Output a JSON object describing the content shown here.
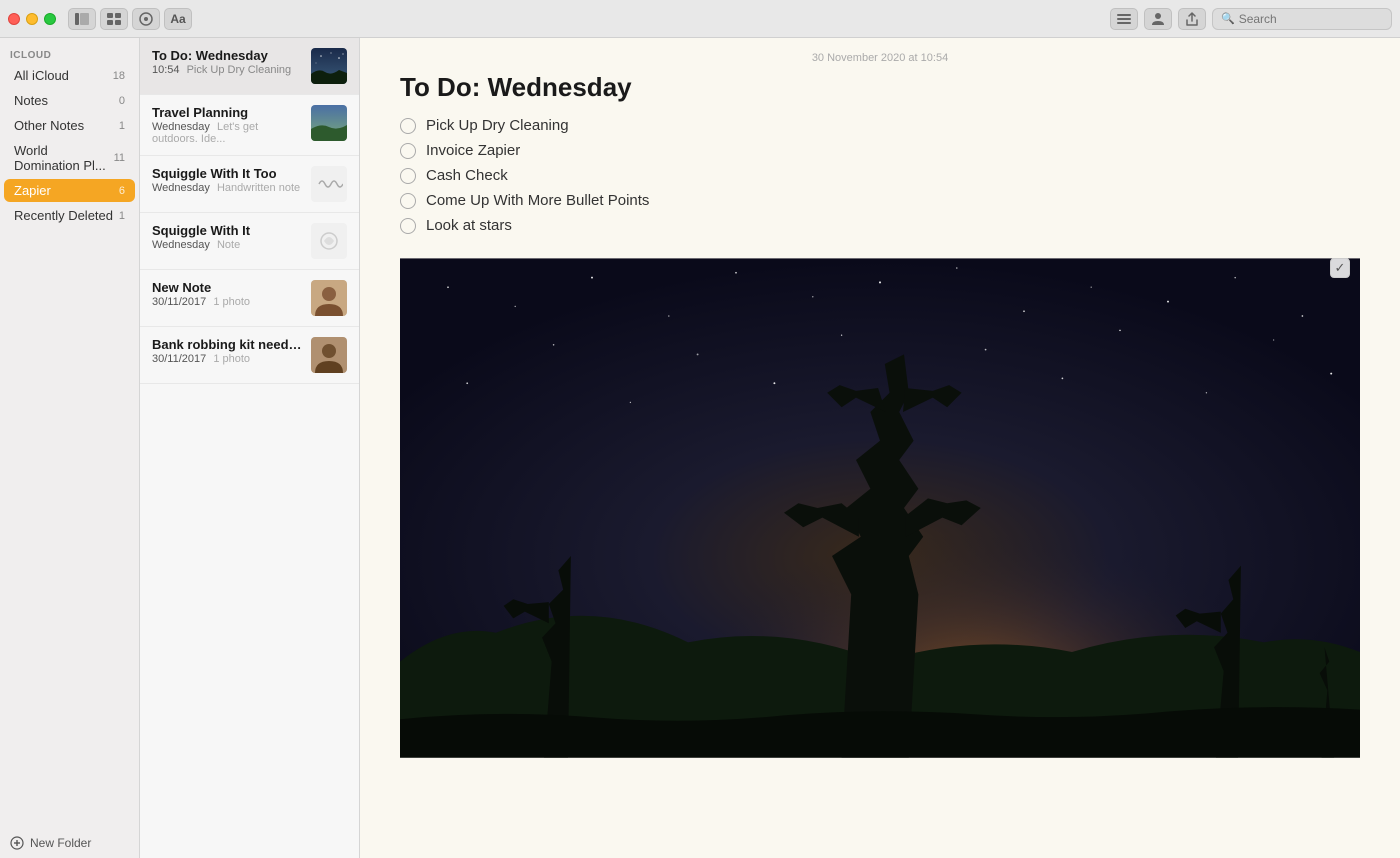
{
  "titlebar": {
    "traffic_lights": [
      "close",
      "minimize",
      "maximize"
    ],
    "center_buttons": [
      {
        "label": "⊞",
        "name": "sidebar-toggle"
      },
      {
        "label": "⊡",
        "name": "gallery-toggle"
      },
      {
        "label": "✂",
        "name": "attach-toggle"
      },
      {
        "label": "✎",
        "name": "edit-toggle"
      }
    ],
    "right_buttons": [
      {
        "label": "⊞",
        "name": "view-options"
      },
      {
        "label": "⊕",
        "name": "account"
      },
      {
        "label": "⬆",
        "name": "share"
      }
    ],
    "search_placeholder": "Search"
  },
  "sidebar": {
    "section_label": "iCloud",
    "items": [
      {
        "label": "All iCloud",
        "count": "18",
        "active": false
      },
      {
        "label": "Notes",
        "count": "0",
        "active": false
      },
      {
        "label": "Other Notes",
        "count": "1",
        "active": false
      },
      {
        "label": "World Domination Pl...",
        "count": "11",
        "active": false
      },
      {
        "label": "Zapier",
        "count": "6",
        "active": true
      },
      {
        "label": "Recently Deleted",
        "count": "1",
        "active": false
      }
    ],
    "footer": {
      "label": "New Folder"
    }
  },
  "note_list": {
    "items": [
      {
        "id": "todo-wed",
        "title": "To Do: Wednesday",
        "date": "10:54",
        "preview": "Pick Up Dry Cleaning",
        "has_thumbnail": true,
        "thumbnail_type": "photo",
        "selected": true
      },
      {
        "id": "travel",
        "title": "Travel Planning",
        "date": "Wednesday",
        "preview": "Let's get outdoors. Ide...",
        "has_thumbnail": true,
        "thumbnail_type": "photo",
        "selected": false
      },
      {
        "id": "squiggle-too",
        "title": "Squiggle With It Too",
        "date": "Wednesday",
        "preview": "Handwritten note",
        "has_thumbnail": true,
        "thumbnail_type": "squiggle",
        "selected": false
      },
      {
        "id": "squiggle",
        "title": "Squiggle With It",
        "date": "Wednesday",
        "preview": "Note",
        "has_thumbnail": true,
        "thumbnail_type": "squiggle2",
        "selected": false
      },
      {
        "id": "new-note",
        "title": "New Note",
        "date": "30/11/2017",
        "preview": "1 photo",
        "has_thumbnail": true,
        "thumbnail_type": "person",
        "selected": false
      },
      {
        "id": "bank-robbing",
        "title": "Bank robbing kit needed:",
        "date": "30/11/2017",
        "preview": "1 photo",
        "has_thumbnail": true,
        "thumbnail_type": "person2",
        "selected": false
      }
    ]
  },
  "detail": {
    "timestamp": "30 November 2020 at 10:54",
    "title": "To Do: Wednesday",
    "checklist": [
      {
        "text": "Pick Up Dry Cleaning",
        "checked": false
      },
      {
        "text": "Invoice Zapier",
        "checked": false
      },
      {
        "text": "Cash Check",
        "checked": false
      },
      {
        "text": "Come Up With More Bullet Points",
        "checked": false
      },
      {
        "text": "Look at stars",
        "checked": false
      }
    ],
    "image_checkbox_label": "✓"
  }
}
